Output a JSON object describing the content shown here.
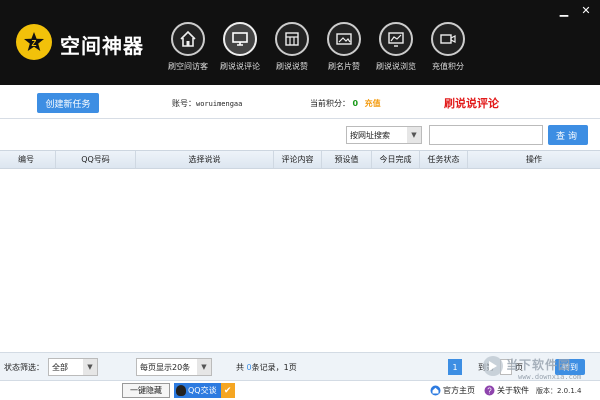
{
  "app": {
    "name": "空间神器"
  },
  "window": {
    "minimize": "▁",
    "close": "✕"
  },
  "nav": [
    {
      "label": "刷空间访客",
      "icon": "home-icon"
    },
    {
      "label": "刷说说评论",
      "icon": "monitor-icon",
      "active": true
    },
    {
      "label": "刷说说赞",
      "icon": "calendar-icon"
    },
    {
      "label": "刷名片赞",
      "icon": "card-icon"
    },
    {
      "label": "刷说说浏览",
      "icon": "chart-icon"
    },
    {
      "label": "充值积分",
      "icon": "video-icon"
    }
  ],
  "info": {
    "create_label": "创建新任务",
    "account_label": "账号：",
    "account_value": "woruimengaa",
    "points_label": "当前积分：",
    "points_value": "0",
    "recharge_label": "充值",
    "mode_title": "刷说说评论"
  },
  "search": {
    "type_selected": "按网址搜索",
    "input_value": "",
    "query_label": "查询"
  },
  "table": {
    "columns": [
      "编号",
      "QQ号码",
      "选择说说",
      "评论内容",
      "预设值",
      "今日完成",
      "任务状态",
      "操作"
    ],
    "rows": []
  },
  "bottom": {
    "status_filter_label": "状态筛选：",
    "status_filter_value": "全部",
    "page_size_value": "每页显示20条",
    "records_prefix": "共",
    "records_count": "0",
    "records_suffix": "条记录，1页",
    "current_page": "1",
    "goto_prefix": "到第",
    "goto_suffix": "页",
    "go_label": "转到"
  },
  "watermark": {
    "text": "当下软件园",
    "url": "www.downxia.com"
  },
  "footer": {
    "hide_label": "一键隐藏",
    "qq_talk_label": "QQ交谈",
    "home_label": "官方主页",
    "about_label": "关于软件",
    "version_label": "版本：",
    "version_value": "2.0.1.4"
  },
  "colors": {
    "accent": "#3d8ee3",
    "brand_yellow": "#f2c10a",
    "mode_red": "#e21b1b",
    "points_green": "#1a9a1a",
    "recharge_orange": "#f39c12"
  }
}
